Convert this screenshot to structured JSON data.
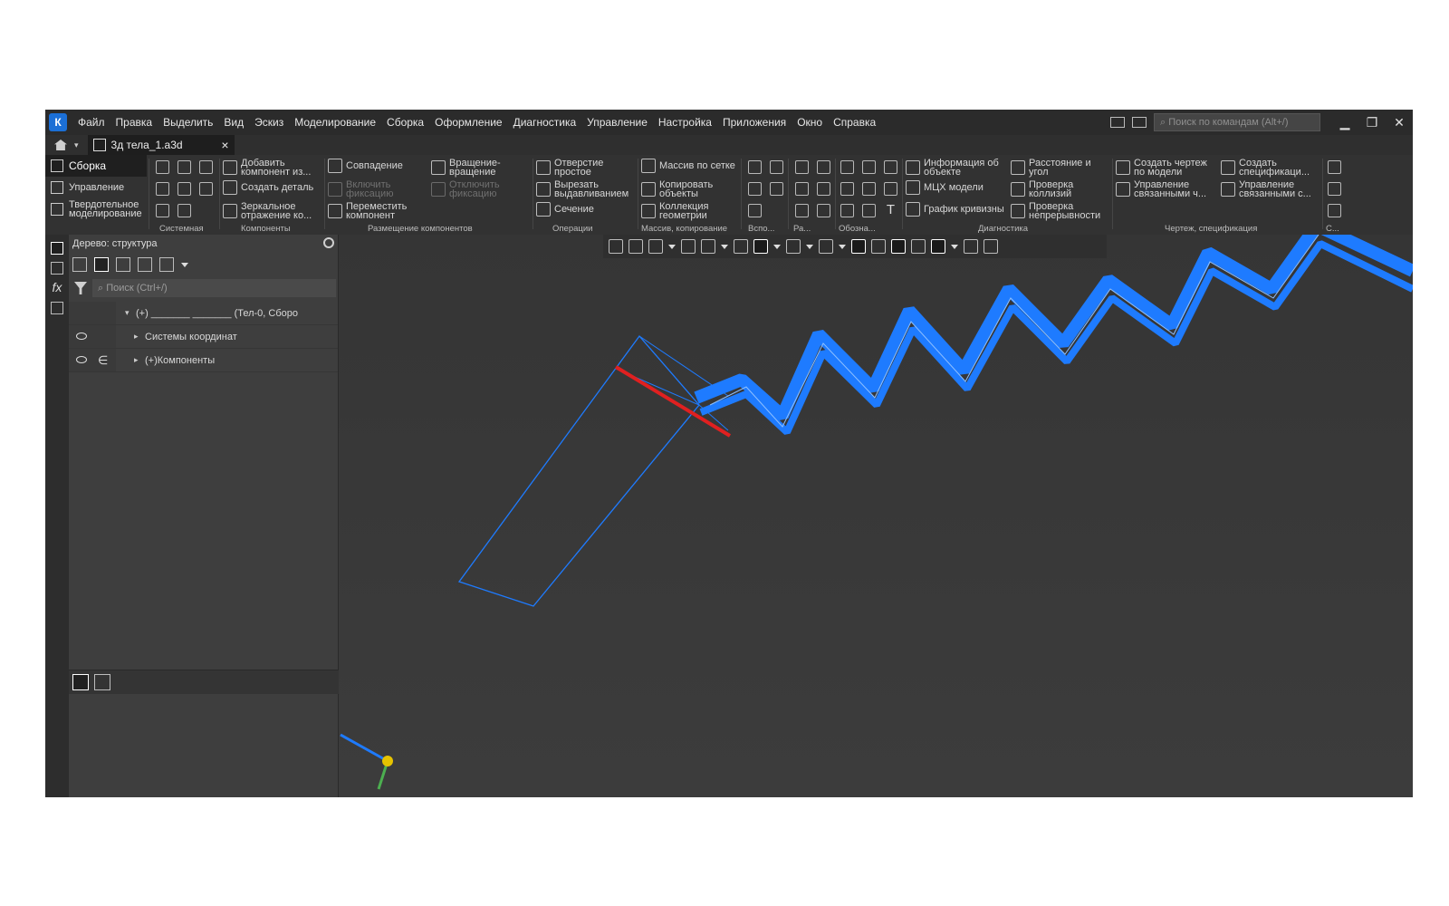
{
  "menu": [
    "Файл",
    "Правка",
    "Выделить",
    "Вид",
    "Эскиз",
    "Моделирование",
    "Сборка",
    "Оформление",
    "Диагностика",
    "Управление",
    "Настройка",
    "Приложения",
    "Окно",
    "Справка"
  ],
  "command_search_placeholder": "Поиск по командам (Alt+/)",
  "doc_tab": {
    "title": "3д тела_1.a3d",
    "close": "×"
  },
  "modes": [
    "Сборка",
    "Управление",
    "Твердотельное моделирование"
  ],
  "ribbon": {
    "components": [
      "Добавить компонент из...",
      "Создать деталь",
      "Зеркальное отражение ко..."
    ],
    "placement": [
      "Совпадение",
      "Включить фиксацию",
      "Переместить компонент",
      "Вращение-вращение",
      "Отключить фиксацию"
    ],
    "operations": [
      "Отверстие простое",
      "Вырезать выдавливанием",
      "Сечение"
    ],
    "array": [
      "Массив по сетке",
      "Копировать объекты",
      "Коллекция геометрии"
    ],
    "diagnostics": [
      "Информация об объекте",
      "МЦХ модели",
      "График кривизны",
      "Расстояние и угол",
      "Проверка коллизий",
      "Проверка непрерывности"
    ],
    "drawing": [
      "Создать чертеж по модели",
      "Управление связанными ч...",
      "Создать спецификаци...",
      "Управление связанными с..."
    ],
    "groups": [
      "Системная",
      "Компоненты",
      "Размещение компонентов",
      "Операции",
      "Массив, копирование",
      "Вспо...",
      "Ра...",
      "Обозна...",
      "Диагностика",
      "Чертеж, спецификация",
      "С..."
    ]
  },
  "tree_panel": {
    "title": "Дерево: структура",
    "search_placeholder": "Поиск (Ctrl+/)",
    "rows": [
      {
        "label": "(+) _______ _______ (Тел-0, Сборо"
      },
      {
        "label": "Системы координат"
      },
      {
        "label": "(+)Компоненты"
      }
    ]
  },
  "colors": {
    "model_blue": "#1e7bff",
    "selection_red": "#e02020",
    "viewport_bg": "#383838"
  },
  "icons": [
    "app-logo-icon",
    "home-icon",
    "gear-icon",
    "filter-icon",
    "search-icon",
    "eye-icon",
    "axis-triad"
  ]
}
